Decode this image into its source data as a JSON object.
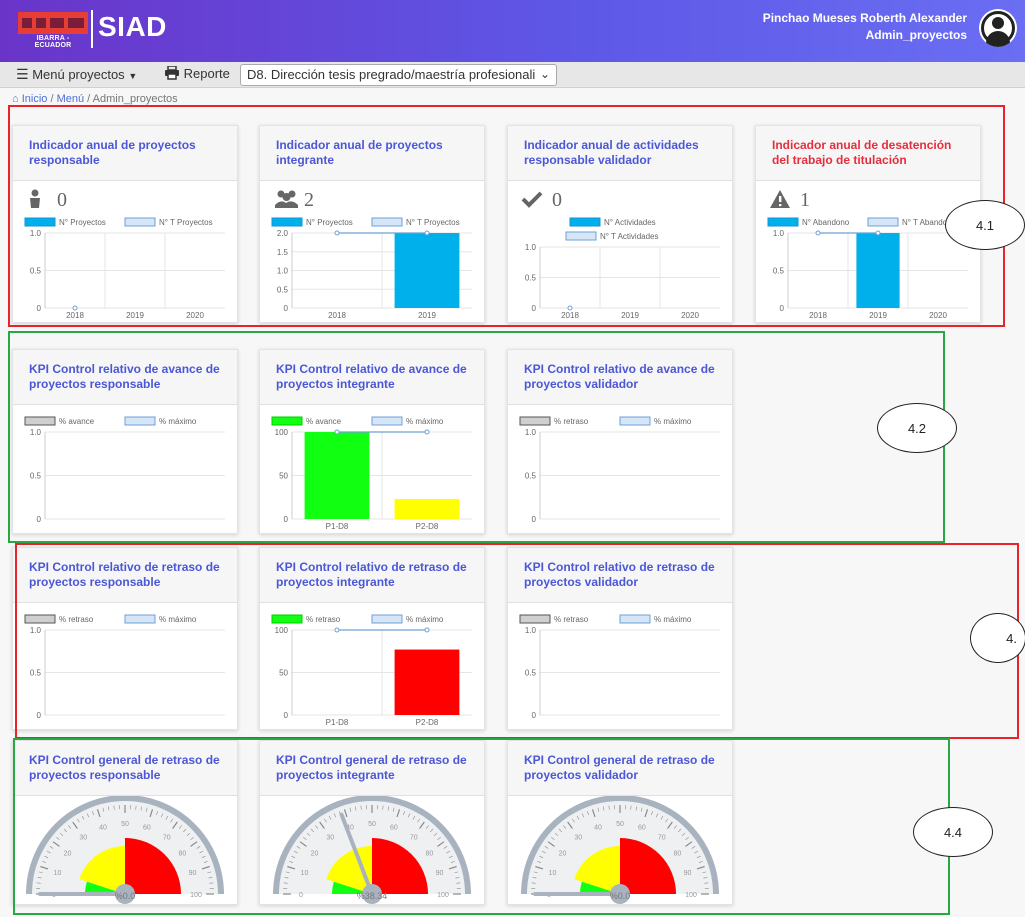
{
  "header": {
    "logo_text": "IBARRA - ECUADOR",
    "app_name": "SIAD",
    "user_name": "Pinchao Mueses Roberth Alexander",
    "user_role": "Admin_proyectos"
  },
  "menubar": {
    "menu_label": "Menú proyectos",
    "report_label": "Reporte",
    "project_select": "D8. Dirección tesis pregrado/maestría profesionali"
  },
  "breadcrumb": [
    "Inicio",
    "Menú",
    "Admin_proyectos"
  ],
  "colors": {
    "accent": "#4b57d6",
    "alert": "#e52e3d",
    "bar": "#00b0ea",
    "green": "#11ff11",
    "yellow": "#ffff00",
    "red": "#ff0000"
  },
  "cards": [
    {
      "id": "ind-resp",
      "title": "Indicador anual de proyectos responsable",
      "icon": "person-icon",
      "count": "0",
      "chart_data": {
        "type": "bar",
        "legend": [
          "N° Proyectos",
          "N° T Proyectos"
        ],
        "legend_rows": 1,
        "categories": [
          "2018",
          "2019",
          "2020"
        ],
        "values": [
          0,
          0,
          0
        ],
        "line": [
          0,
          null,
          null
        ],
        "yticks": [
          "1.0",
          "0.5",
          "0"
        ],
        "ylim": [
          0,
          1
        ]
      }
    },
    {
      "id": "ind-int",
      "title": "Indicador anual de proyectos integrante",
      "icon": "users-icon",
      "count": "2",
      "chart_data": {
        "type": "bar",
        "legend": [
          "N° Proyectos",
          "N° T Proyectos"
        ],
        "legend_rows": 1,
        "categories": [
          "2018",
          "2019"
        ],
        "values": [
          0,
          2
        ],
        "line": [
          2,
          2
        ],
        "yticks": [
          "2.0",
          "1.5",
          "1.0",
          "0.5",
          "0"
        ],
        "ylim": [
          0,
          2
        ]
      }
    },
    {
      "id": "ind-act",
      "title": "Indicador anual de actividades responsable validador",
      "icon": "check-icon",
      "count": "0",
      "chart_data": {
        "type": "bar",
        "legend": [
          "N° Actividades",
          "N° T Actividades"
        ],
        "legend_rows": 2,
        "categories": [
          "2018",
          "2019",
          "2020"
        ],
        "values": [
          0,
          0,
          0
        ],
        "line": [
          0,
          null,
          null
        ],
        "yticks": [
          "1.0",
          "0.5",
          "0"
        ],
        "ylim": [
          0,
          1
        ]
      }
    },
    {
      "id": "ind-des",
      "title": "Indicador anual de desatención del trabajo de titulación",
      "title_red": true,
      "icon": "warning-icon",
      "count": "1",
      "chart_data": {
        "type": "bar",
        "legend": [
          "N° Abandono",
          "N° T Abando"
        ],
        "legend_rows": 1,
        "categories": [
          "2018",
          "2019",
          "2020"
        ],
        "values": [
          0,
          1,
          0
        ],
        "line": [
          1,
          1,
          null
        ],
        "yticks": [
          "1.0",
          "0.5",
          "0"
        ],
        "ylim": [
          0,
          1
        ]
      }
    },
    {
      "id": "kpi-av-resp",
      "title": "KPI Control relativo de avance de proyectos responsable",
      "chart_data": {
        "type": "bar",
        "legend": [
          "% avance",
          "% máximo"
        ],
        "legend_rows": 1,
        "legend_first": "gray",
        "categories": [],
        "values": [],
        "line": [],
        "yticks": [
          "1.0",
          "0.5",
          "0"
        ],
        "ylim": [
          0,
          1
        ]
      }
    },
    {
      "id": "kpi-av-int",
      "title": "KPI Control relativo de avance de proyectos integrante",
      "chart_data": {
        "type": "bar",
        "legend": [
          "% avance",
          "% máximo"
        ],
        "legend_rows": 1,
        "legend_first": "green",
        "categories": [
          "P1-D8",
          "P2-D8"
        ],
        "values": [
          100,
          23
        ],
        "line": [
          100,
          100
        ],
        "bar_colors": [
          "green",
          "yellow"
        ],
        "yticks": [
          "100",
          "50",
          "0"
        ],
        "ylim": [
          0,
          100
        ]
      }
    },
    {
      "id": "kpi-av-val",
      "title": "KPI Control relativo de avance de proyectos validador",
      "chart_data": {
        "type": "bar",
        "legend": [
          "% retraso",
          "% máximo"
        ],
        "legend_rows": 1,
        "legend_first": "gray",
        "categories": [],
        "values": [],
        "line": [],
        "yticks": [
          "1.0",
          "0.5",
          "0"
        ],
        "ylim": [
          0,
          1
        ]
      }
    },
    {
      "id": "kpi-re-resp",
      "title": "KPI Control relativo de retraso de proyectos responsable",
      "chart_data": {
        "type": "bar",
        "legend": [
          "% retraso",
          "% máximo"
        ],
        "legend_rows": 1,
        "legend_first": "gray",
        "categories": [],
        "values": [],
        "line": [],
        "yticks": [
          "1.0",
          "0.5",
          "0"
        ],
        "ylim": [
          0,
          1
        ]
      }
    },
    {
      "id": "kpi-re-int",
      "title": "KPI Control relativo de retraso de proyectos integrante",
      "chart_data": {
        "type": "bar",
        "legend": [
          "% retraso",
          "% máximo"
        ],
        "legend_rows": 1,
        "legend_first": "green",
        "categories": [
          "P1-D8",
          "P2-D8"
        ],
        "values": [
          0,
          77
        ],
        "line": [
          100,
          100
        ],
        "bar_colors": [
          "green",
          "red"
        ],
        "yticks": [
          "100",
          "50",
          "0"
        ],
        "ylim": [
          0,
          100
        ]
      }
    },
    {
      "id": "kpi-re-val",
      "title": "KPI Control relativo de retraso de proyectos validador",
      "chart_data": {
        "type": "bar",
        "legend": [
          "% retraso",
          "% máximo"
        ],
        "legend_rows": 1,
        "legend_first": "gray",
        "categories": [],
        "values": [],
        "line": [],
        "yticks": [
          "1.0",
          "0.5",
          "0"
        ],
        "ylim": [
          0,
          1
        ]
      }
    },
    {
      "id": "gauge-resp",
      "title": "KPI Control general de retraso de proyectos responsable",
      "gauge": {
        "value": 0,
        "label": "%0.0",
        "ticks": [
          "0",
          "10",
          "20",
          "30",
          "40",
          "50",
          "60",
          "70",
          "80",
          "90",
          "100"
        ]
      }
    },
    {
      "id": "gauge-int",
      "title": "KPI Control general de retraso de proyectos integrante",
      "gauge": {
        "value": 38.34,
        "label": "%38.34",
        "ticks": [
          "0",
          "10",
          "20",
          "30",
          "40",
          "50",
          "60",
          "70",
          "80",
          "90",
          "100"
        ]
      }
    },
    {
      "id": "gauge-val",
      "title": "KPI Control general de retraso de proyectos validador",
      "gauge": {
        "value": 0,
        "label": "%0.0",
        "ticks": [
          "0",
          "10",
          "20",
          "30",
          "40",
          "50",
          "60",
          "70",
          "80",
          "90",
          "100"
        ]
      }
    }
  ],
  "annotations": [
    "4.1",
    "4.2",
    "4.",
    "4.4"
  ]
}
